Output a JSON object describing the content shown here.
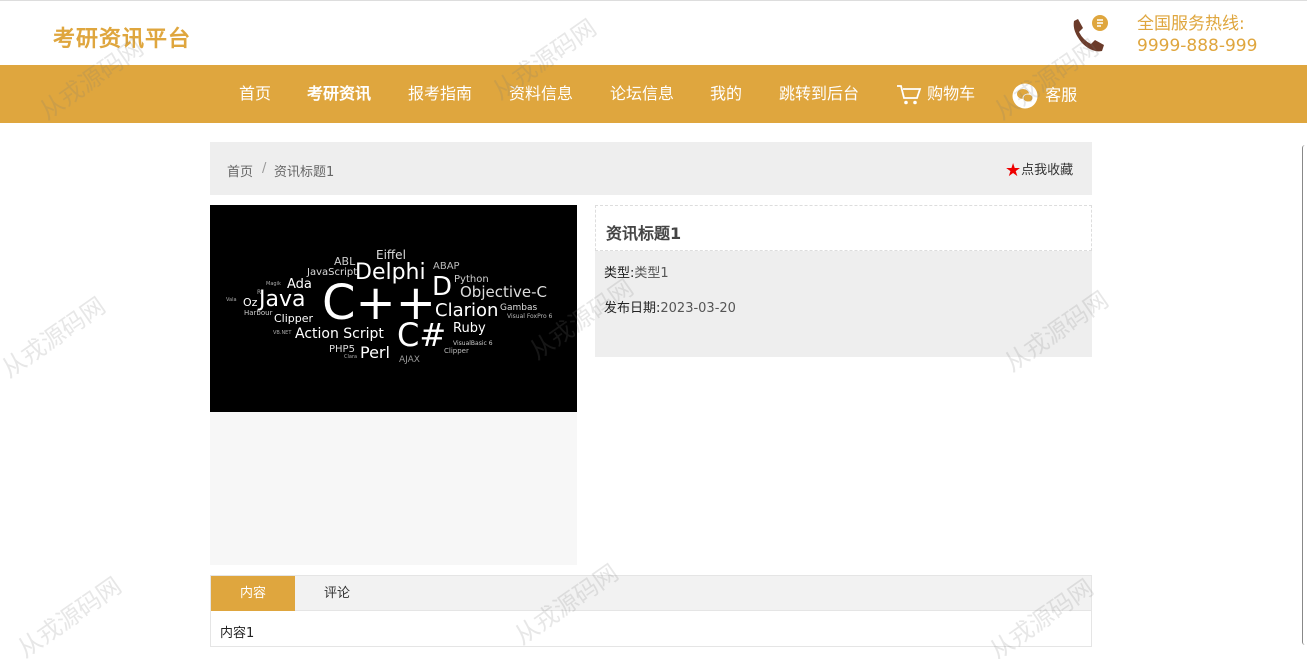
{
  "header": {
    "logo": "考研资讯平台",
    "hotline_label": "全国服务热线:",
    "hotline_number": "9999-888-999",
    "hotline_icon": "phone-icon"
  },
  "nav": {
    "items": [
      {
        "label": "首页"
      },
      {
        "label": "考研资讯",
        "active": true
      },
      {
        "label": "报考指南"
      },
      {
        "label": "资料信息"
      },
      {
        "label": "论坛信息"
      },
      {
        "label": "我的"
      },
      {
        "label": "跳转到后台"
      },
      {
        "label": "购物车",
        "icon": "cart-icon"
      },
      {
        "label": "客服",
        "icon": "wechat-icon"
      }
    ]
  },
  "breadcrumb": {
    "home": "首页",
    "separator": "/",
    "current": "资讯标题1",
    "favorite_label": "点我收藏"
  },
  "image": {
    "words": [
      "ABL",
      "Eiffel",
      "JavaScript",
      "Delphi",
      "ABAP",
      "Python",
      "Objective-C",
      "Ada",
      "Java",
      "C++",
      "D",
      "Clarion",
      "Gambas",
      "Visual FoxPro 6",
      "Oz",
      "Harbour",
      "Clipper",
      "Action Script",
      "C#",
      "Ruby",
      "VB.NET",
      "PHP5",
      "Perl",
      "VisualBasic 6",
      "Clipper",
      "AJAX",
      "Magik",
      "Vala",
      "R",
      "Clara"
    ]
  },
  "info": {
    "title": "资讯标题1",
    "type_label": "类型:",
    "type_value": "类型1",
    "date_label": "发布日期:",
    "date_value": "2023-03-20"
  },
  "tabs": {
    "items": [
      {
        "label": "内容",
        "active": true
      },
      {
        "label": "评论"
      }
    ],
    "content": "内容1"
  },
  "watermark": "从戎源码网",
  "colors": {
    "accent": "#DFA63E",
    "star": "#E00000"
  }
}
